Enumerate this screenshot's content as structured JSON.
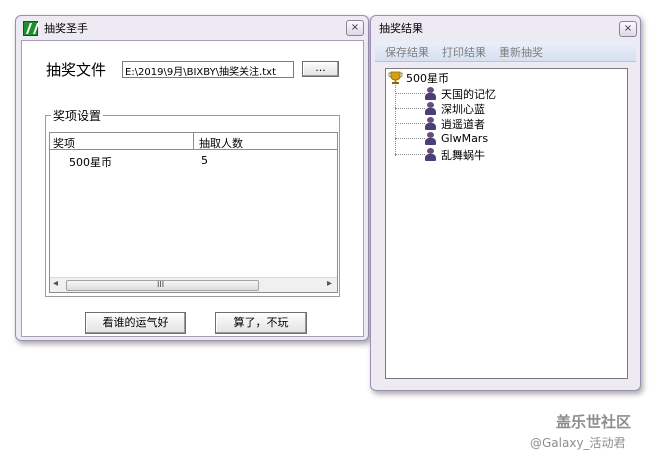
{
  "main_window": {
    "title": "抽奖圣手",
    "close_glyph": "×",
    "file_label": "抽奖文件",
    "file_path": "E:\\2019\\9月\\BIXBY\\抽奖关注.txt",
    "browse_label": "...",
    "group_label": "奖项设置",
    "table": {
      "headers": [
        "奖项",
        "抽取人数"
      ],
      "rows": [
        [
          "500星币",
          "5"
        ]
      ]
    },
    "scroll_left": "◂",
    "scroll_right": "▸",
    "scroll_grip": "III",
    "lucky_button": "看谁的运气好",
    "quit_button": "算了，不玩"
  },
  "result_window": {
    "title": "抽奖结果",
    "close_glyph": "×",
    "menu": [
      "保存结果",
      "打印结果",
      "重新抽奖"
    ],
    "tree": {
      "root": "500星币",
      "winners": [
        "天国的记忆",
        "深圳心蓝",
        "逍遥道者",
        "GlwMars",
        "乱舞蜗牛"
      ]
    }
  },
  "watermark": {
    "line1": "盖乐世社区",
    "line2": "@Galaxy_活动君"
  },
  "colors": {
    "frame": "#eeeaf3",
    "frame_border": "#9a8fb0",
    "menu_disabled": "#7d7d7d",
    "trophy": "#d4a017",
    "watermark": "#8d8d8d"
  },
  "icons": {
    "app": "app-logo-icon",
    "trophy": "trophy-icon",
    "winner": "person-icon"
  }
}
